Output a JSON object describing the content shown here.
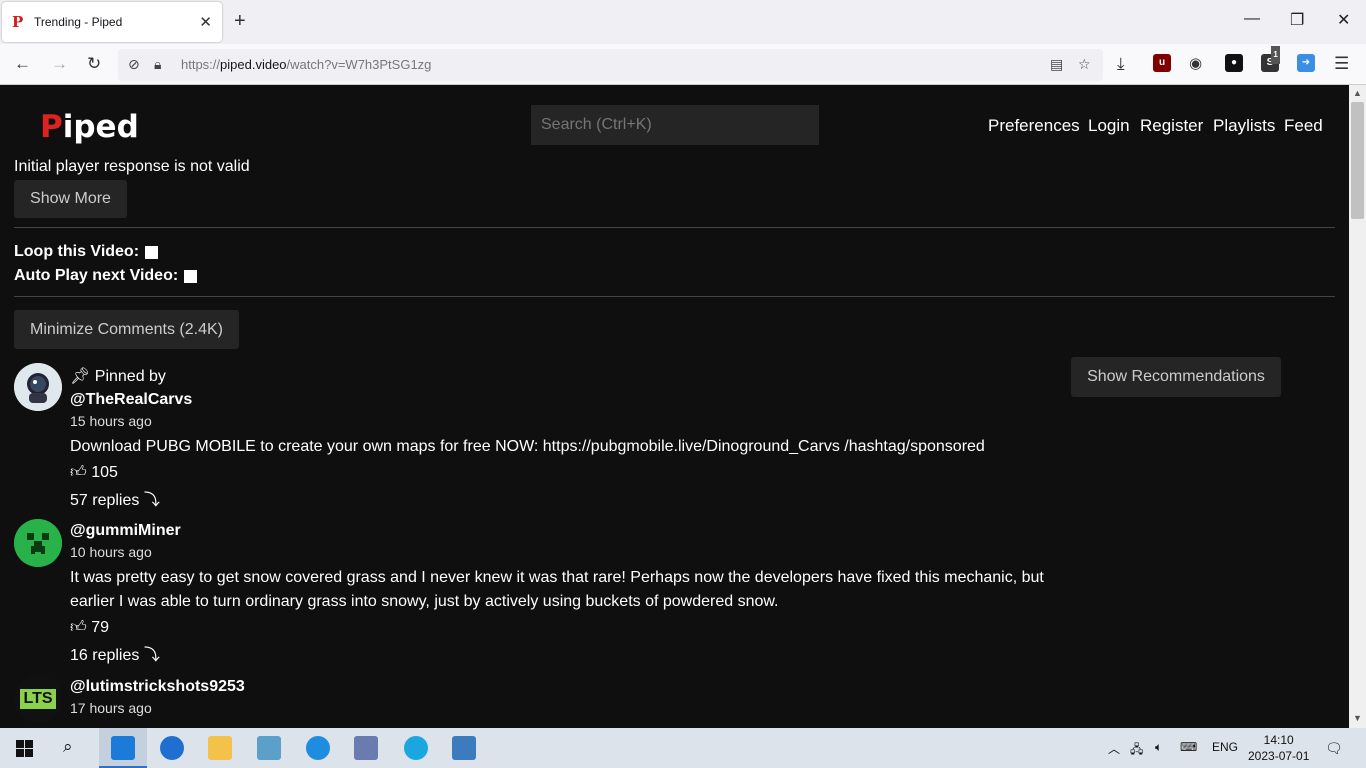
{
  "browser": {
    "tab_title": "Trending - Piped",
    "new_tab": "+",
    "url_prefix": "https://",
    "url_domain": "piped.video",
    "url_path": "/watch?v=W7h3PtSG1zg",
    "ext_badge": "1"
  },
  "site": {
    "logo_p": "P",
    "logo_rest": "iped",
    "search_placeholder": "Search (Ctrl+K)",
    "nav": [
      "Preferences",
      "Login",
      "Register",
      "Playlists",
      "Feed"
    ]
  },
  "player": {
    "error": "Initial player response is not valid",
    "show_more": "Show More",
    "loop_label": "Loop this Video:",
    "autoplay_label": "Auto Play next Video:",
    "loop_checked": false,
    "autoplay_checked": false
  },
  "comments": {
    "minimize_label": "Minimize Comments (2.4K)",
    "show_recommendations": "Show Recommendations",
    "items": [
      {
        "pinned_text": "Pinned by",
        "author": "@TheRealCarvs",
        "time": "15 hours ago",
        "text": "Download PUBG MOBILE to create your own maps for free NOW: https://pubgmobile.live/Dinoground_Carvs /hashtag/sponsored",
        "likes": "105",
        "replies": "57 replies"
      },
      {
        "author": "@gummiMiner",
        "time": "10 hours ago",
        "text": "It was pretty easy to get snow covered grass and I never knew it was that rare! Perhaps now the developers have fixed this mechanic, but earlier I was able to turn ordinary grass into snowy, just by actively using buckets of powdered snow.",
        "likes": "79",
        "replies": "16 replies"
      },
      {
        "author": "@lutimstrickshots9253",
        "avatar_text": "LTS",
        "time": "17 hours ago"
      }
    ]
  },
  "taskbar": {
    "lang": "ENG",
    "time": "14:10",
    "date": "2023-07-01"
  }
}
